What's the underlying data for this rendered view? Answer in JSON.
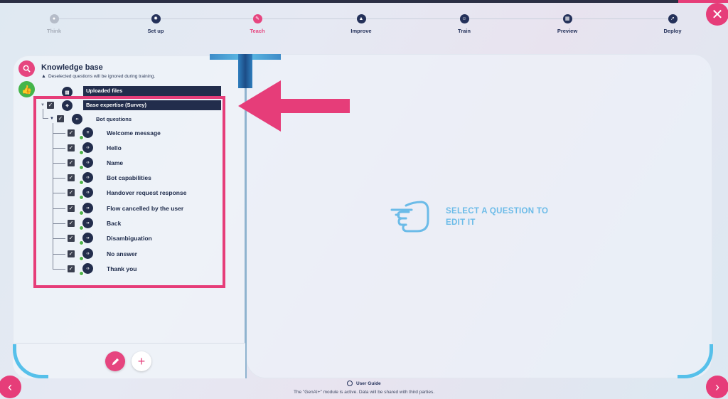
{
  "steps": [
    {
      "label": "Think",
      "state": "muted",
      "icon": "lightbulb-icon"
    },
    {
      "label": "Set up",
      "state": "done",
      "icon": "gear-icon"
    },
    {
      "label": "Teach",
      "state": "active",
      "icon": "pencil-icon"
    },
    {
      "label": "Improve",
      "state": "done",
      "icon": "triangle-icon"
    },
    {
      "label": "Train",
      "state": "done",
      "icon": "robot-icon"
    },
    {
      "label": "Preview",
      "state": "done",
      "icon": "calendar-icon"
    },
    {
      "label": "Deploy",
      "state": "done",
      "icon": "rocket-icon"
    }
  ],
  "knowledge_base": {
    "title": "Knowledge base",
    "note": "Deselected questions will be ignored during training.",
    "uploaded_files": "Uploaded files",
    "base_expertise": "Base expertise (Survey)",
    "bot_questions": "Bot questions",
    "questions": [
      "Welcome message",
      "Hello",
      "Name",
      "Bot capabilities",
      "Handover request response",
      "Flow cancelled by the user",
      "Back",
      "Disambiguation",
      "No answer",
      "Thank you"
    ]
  },
  "editor": {
    "hint": "SELECT A QUESTION TO EDIT IT"
  },
  "footer": {
    "user_guide": "User Guide",
    "note": "The \"GenAI+\" module is active. Data will be shared with third parties."
  },
  "colors": {
    "accent": "#e63d79",
    "navy": "#222d4c",
    "hint_blue": "#6bbbe8",
    "success": "#45b54a"
  }
}
